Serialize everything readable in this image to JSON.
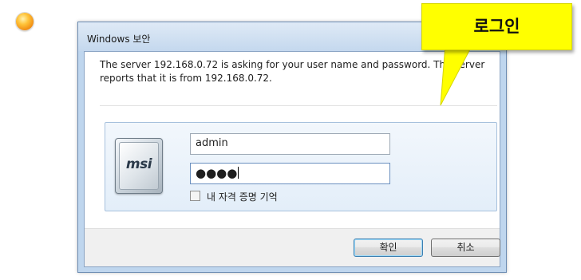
{
  "window": {
    "title": "Windows 보안"
  },
  "message": "The server 192.168.0.72 is asking for your user name and password. The server reports that it is from 192.168.0.72.",
  "credentials": {
    "tile_logo": "msi",
    "username": "admin",
    "password_mask": "●●●●",
    "remember_label": "내 자격 증명 기억"
  },
  "buttons": {
    "ok": "확인",
    "cancel": "취소"
  },
  "callout": {
    "text": "로그인"
  },
  "colors": {
    "callout": "#ffff00",
    "titlebar": "#c4d8ee",
    "panel": "#e3eef9"
  },
  "icons": {
    "bullet": "orange-circle-icon"
  }
}
